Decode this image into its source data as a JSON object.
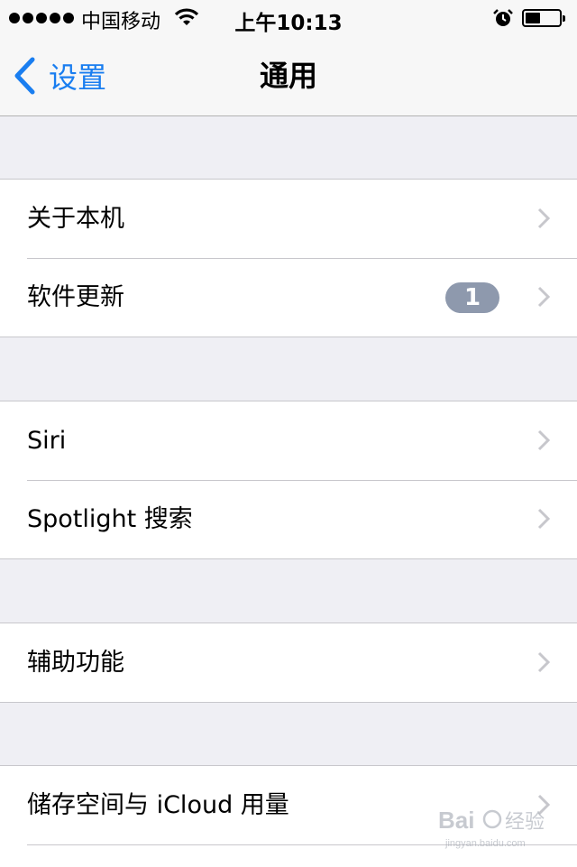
{
  "status_bar": {
    "carrier": "中国移动",
    "time": "上午10:13",
    "battery_level": 0.45,
    "signal_bars": 5
  },
  "nav": {
    "back_label": "设置",
    "title": "通用"
  },
  "groups": [
    {
      "items": [
        {
          "label": "关于本机"
        },
        {
          "label": "软件更新",
          "badge": "1"
        }
      ]
    },
    {
      "items": [
        {
          "label": "Siri"
        },
        {
          "label": "Spotlight 搜索"
        }
      ]
    },
    {
      "items": [
        {
          "label": "辅助功能"
        }
      ]
    },
    {
      "items": [
        {
          "label": "储存空间与 iCloud 用量"
        }
      ]
    }
  ],
  "colors": {
    "accent": "#1a7ef0",
    "background": "#efeff4",
    "badge": "#8e99ad",
    "chevron": "#c7c7cc"
  },
  "watermark": {
    "text": "Baidu经验",
    "subtext": "jingyan.baidu.com"
  }
}
